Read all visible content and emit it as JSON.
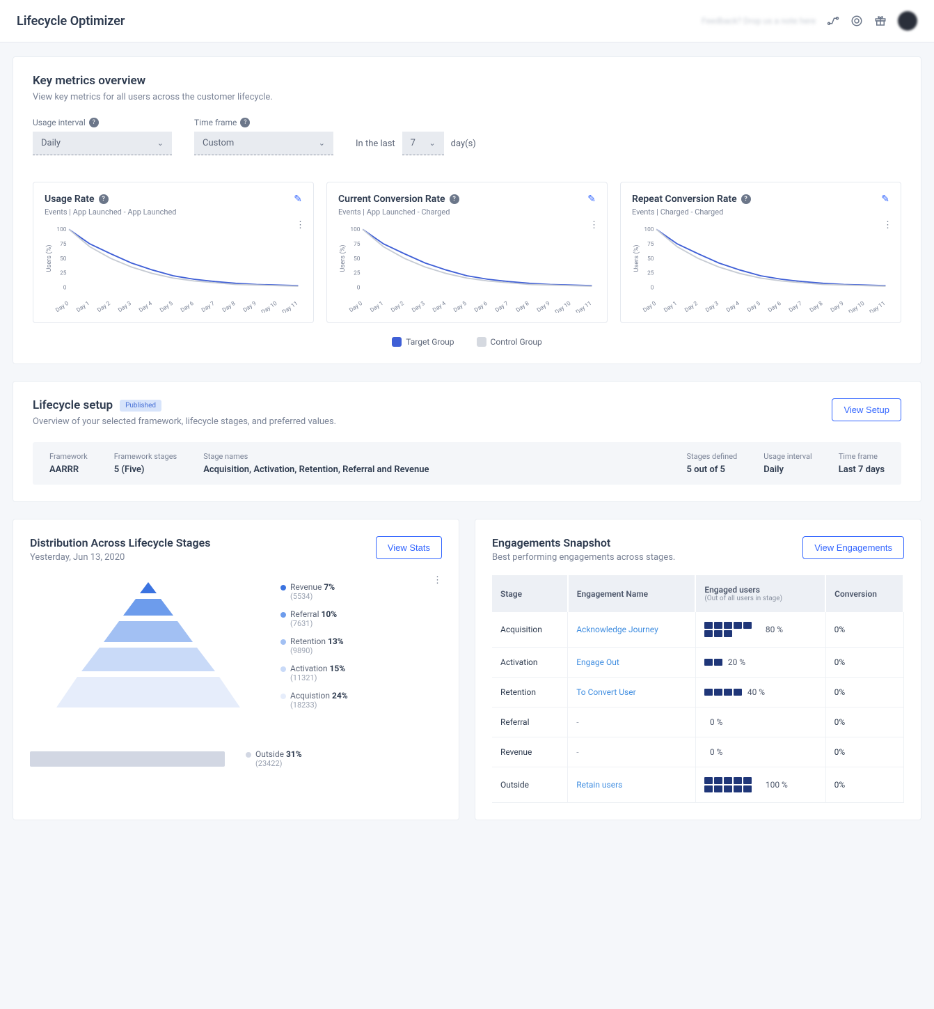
{
  "header": {
    "title": "Lifecycle Optimizer",
    "feedback": "Feedback? Drop us a note here"
  },
  "metrics": {
    "title": "Key metrics overview",
    "subtitle": "View key metrics for all users across the customer lifecycle.",
    "filters": {
      "usage_label": "Usage interval",
      "usage_value": "Daily",
      "timeframe_label": "Time frame",
      "timeframe_value": "Custom",
      "inlast_prefix": "In the last",
      "inlast_value": "7",
      "inlast_suffix": "day(s)"
    },
    "cards": [
      {
        "title": "Usage Rate",
        "events": "Events | App Launched - App Launched"
      },
      {
        "title": "Current Conversion Rate",
        "events": "Events | App Launched - Charged"
      },
      {
        "title": "Repeat Conversion Rate",
        "events": "Events | Charged - Charged"
      }
    ],
    "legend": {
      "target": "Target Group",
      "control": "Control Group"
    }
  },
  "chart_data": {
    "type": "line",
    "categories": [
      "Day 0",
      "Day 1",
      "Day 2",
      "Day 3",
      "Day 4",
      "Day 5",
      "Day 6",
      "Day 7",
      "Day 8",
      "Day 9",
      "Day 10",
      "Day 11"
    ],
    "ylabel": "Users (%)",
    "ylim": [
      0,
      100
    ],
    "yticks": [
      0,
      25,
      50,
      75,
      100
    ],
    "series": [
      {
        "name": "Target Group",
        "color": "#3f5fd6",
        "values": [
          100,
          75,
          58,
          42,
          30,
          20,
          14,
          10,
          7,
          5,
          4,
          3
        ]
      },
      {
        "name": "Control Group",
        "color": "#c6cbd3",
        "values": [
          100,
          70,
          50,
          35,
          24,
          16,
          11,
          8,
          5,
          4,
          3,
          2
        ]
      }
    ],
    "note": "All three metric cards (Usage Rate, Current Conversion Rate, Repeat Conversion Rate) display visually identical decay curves with the same shape."
  },
  "setup": {
    "title": "Lifecycle setup",
    "badge": "Published",
    "subtitle": "Overview of your selected framework, lifecycle stages, and preferred values.",
    "button": "View Setup",
    "cells": {
      "framework_label": "Framework",
      "framework_value": "AARRR",
      "fstages_label": "Framework stages",
      "fstages_value": "5 (Five)",
      "snames_label": "Stage names",
      "snames_value": "Acquisition, Activation, Retention, Referral and Revenue",
      "sdef_label": "Stages defined",
      "sdef_value": "5 out of 5",
      "usage_label": "Usage interval",
      "usage_value": "Daily",
      "tf_label": "Time frame",
      "tf_value": "Last 7 days"
    }
  },
  "distribution": {
    "title": "Distribution Across Lifecycle Stages",
    "subtitle": "Yesterday, Jun 13, 2020",
    "button": "View Stats",
    "stages": [
      {
        "name": "Revenue",
        "pct": "7%",
        "count": "(5534)",
        "color": "#3b73e0"
      },
      {
        "name": "Referral",
        "pct": "10%",
        "count": "(7631)",
        "color": "#6d9cec"
      },
      {
        "name": "Retention",
        "pct": "13%",
        "count": "(9890)",
        "color": "#a2c0f3"
      },
      {
        "name": "Activation",
        "pct": "15%",
        "count": "(11321)",
        "color": "#c9daf8"
      },
      {
        "name": "Acquistion",
        "pct": "24%",
        "count": "(18233)",
        "color": "#e6edfb"
      }
    ],
    "outside": {
      "name": "Outside",
      "pct": "31%",
      "count": "(23422)",
      "color": "#d2d7e3"
    }
  },
  "engagements": {
    "title": "Engagements Snapshot",
    "subtitle": "Best performing engagements across stages.",
    "button": "View Engagements",
    "columns": {
      "stage": "Stage",
      "name": "Engagement Name",
      "engaged": "Engaged users",
      "engaged_sub": "(Out of all users in stage)",
      "conversion": "Conversion"
    },
    "rows": [
      {
        "stage": "Acquisition",
        "name": "Acknowledge Journey",
        "pct": "80 %",
        "blocks": 8,
        "conv": "0%"
      },
      {
        "stage": "Activation",
        "name": "Engage Out",
        "pct": "20 %",
        "blocks": 2,
        "conv": "0%"
      },
      {
        "stage": "Retention",
        "name": "To Convert User",
        "pct": "40 %",
        "blocks": 4,
        "conv": "0%"
      },
      {
        "stage": "Referral",
        "name": "-",
        "pct": "0 %",
        "blocks": 0,
        "conv": "0%"
      },
      {
        "stage": "Revenue",
        "name": "-",
        "pct": "0 %",
        "blocks": 0,
        "conv": "0%"
      },
      {
        "stage": "Outside",
        "name": "Retain users",
        "pct": "100 %",
        "blocks": 10,
        "conv": "0%"
      }
    ]
  }
}
